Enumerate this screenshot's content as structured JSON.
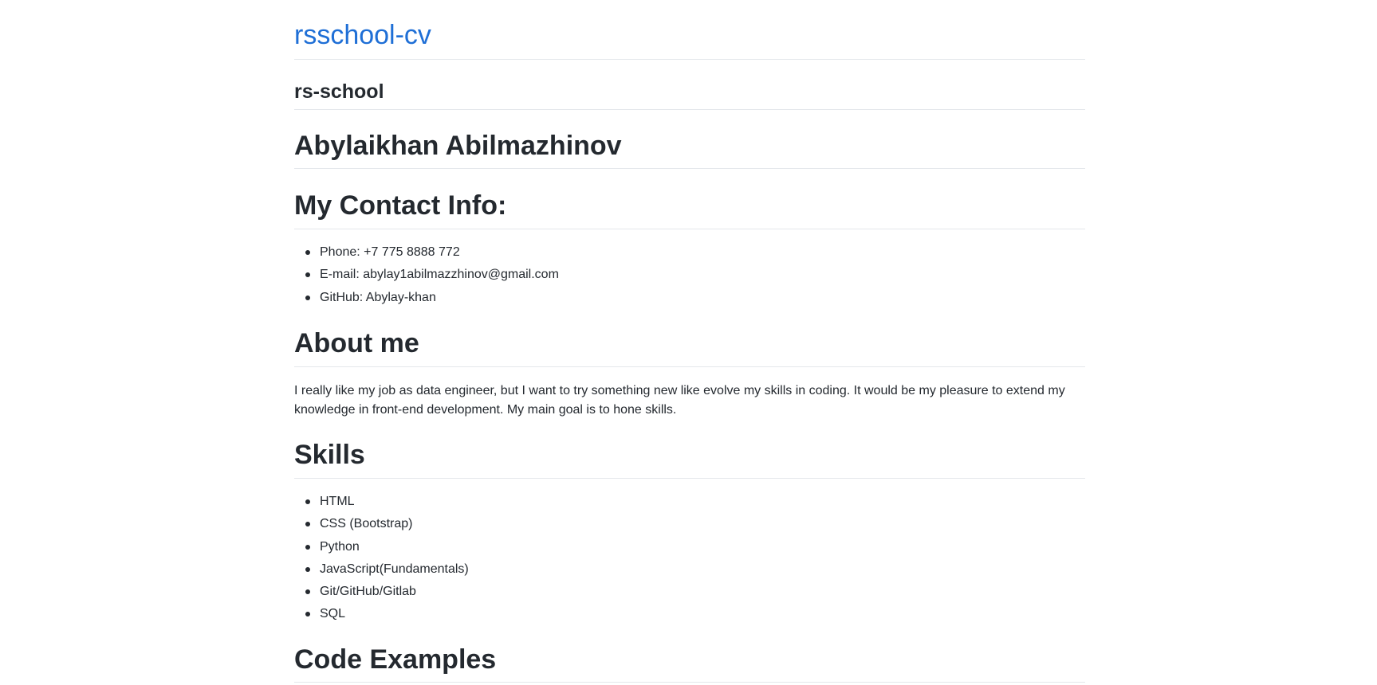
{
  "header": {
    "site_title": "rsschool-cv",
    "site_description": "rs-school"
  },
  "main": {
    "name_heading": "Abylaikhan Abilmazhinov",
    "contact": {
      "heading": "My Contact Info:",
      "items": [
        "Phone: +7 775 8888 772",
        "E-mail: abylay1abilmazzhinov@gmail.com",
        "GitHub: Abylay-khan"
      ]
    },
    "about": {
      "heading": "About me",
      "text": "I really like my job as data engineer, but I want to try something new like evolve my skills in coding. It would be my pleasure to extend my knowledge in front-end development. My main goal is to hone skills."
    },
    "skills": {
      "heading": "Skills",
      "items": [
        "HTML",
        "CSS (Bootstrap)",
        "Python",
        "JavaScript(Fundamentals)",
        "Git/GitHub/Gitlab",
        "SQL"
      ]
    },
    "code_examples": {
      "heading": "Code Examples"
    }
  },
  "colors": {
    "link": "#1f6fd6",
    "text": "#24292f",
    "rule": "#e4e7eb"
  }
}
